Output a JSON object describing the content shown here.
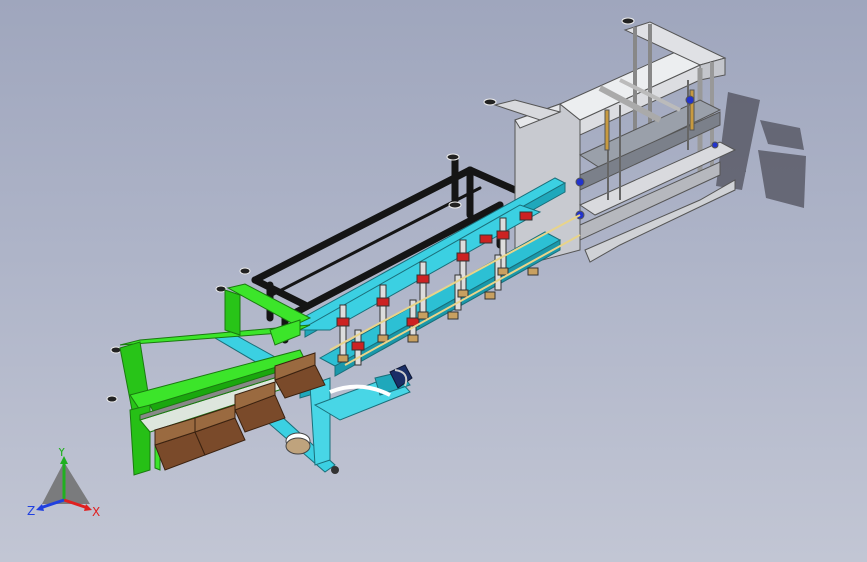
{
  "viewport": {
    "background_top": "#9fa6bd",
    "background_bottom": "#c2c6d4"
  },
  "model": {
    "colors": {
      "green_frame": "#33dd22",
      "cyan_conveyor": "#33c8dd",
      "black_frame": "#151515",
      "gray_frame": "#d4d6dc",
      "boxes": "#7a4a2a",
      "red_grippers": "#cc2222",
      "shadow": "#4a4a55"
    },
    "parts": [
      "green-support-frame",
      "cyan-transfer-conveyor",
      "black-overhead-frame",
      "gray-case-packer",
      "cartons",
      "gripper-heads",
      "swing-arm"
    ]
  },
  "triad": {
    "y_label": "Y",
    "x_label": "X",
    "z_label": "Z",
    "colors": {
      "x": "#e02020",
      "y": "#20b020",
      "z": "#2040e0"
    }
  }
}
